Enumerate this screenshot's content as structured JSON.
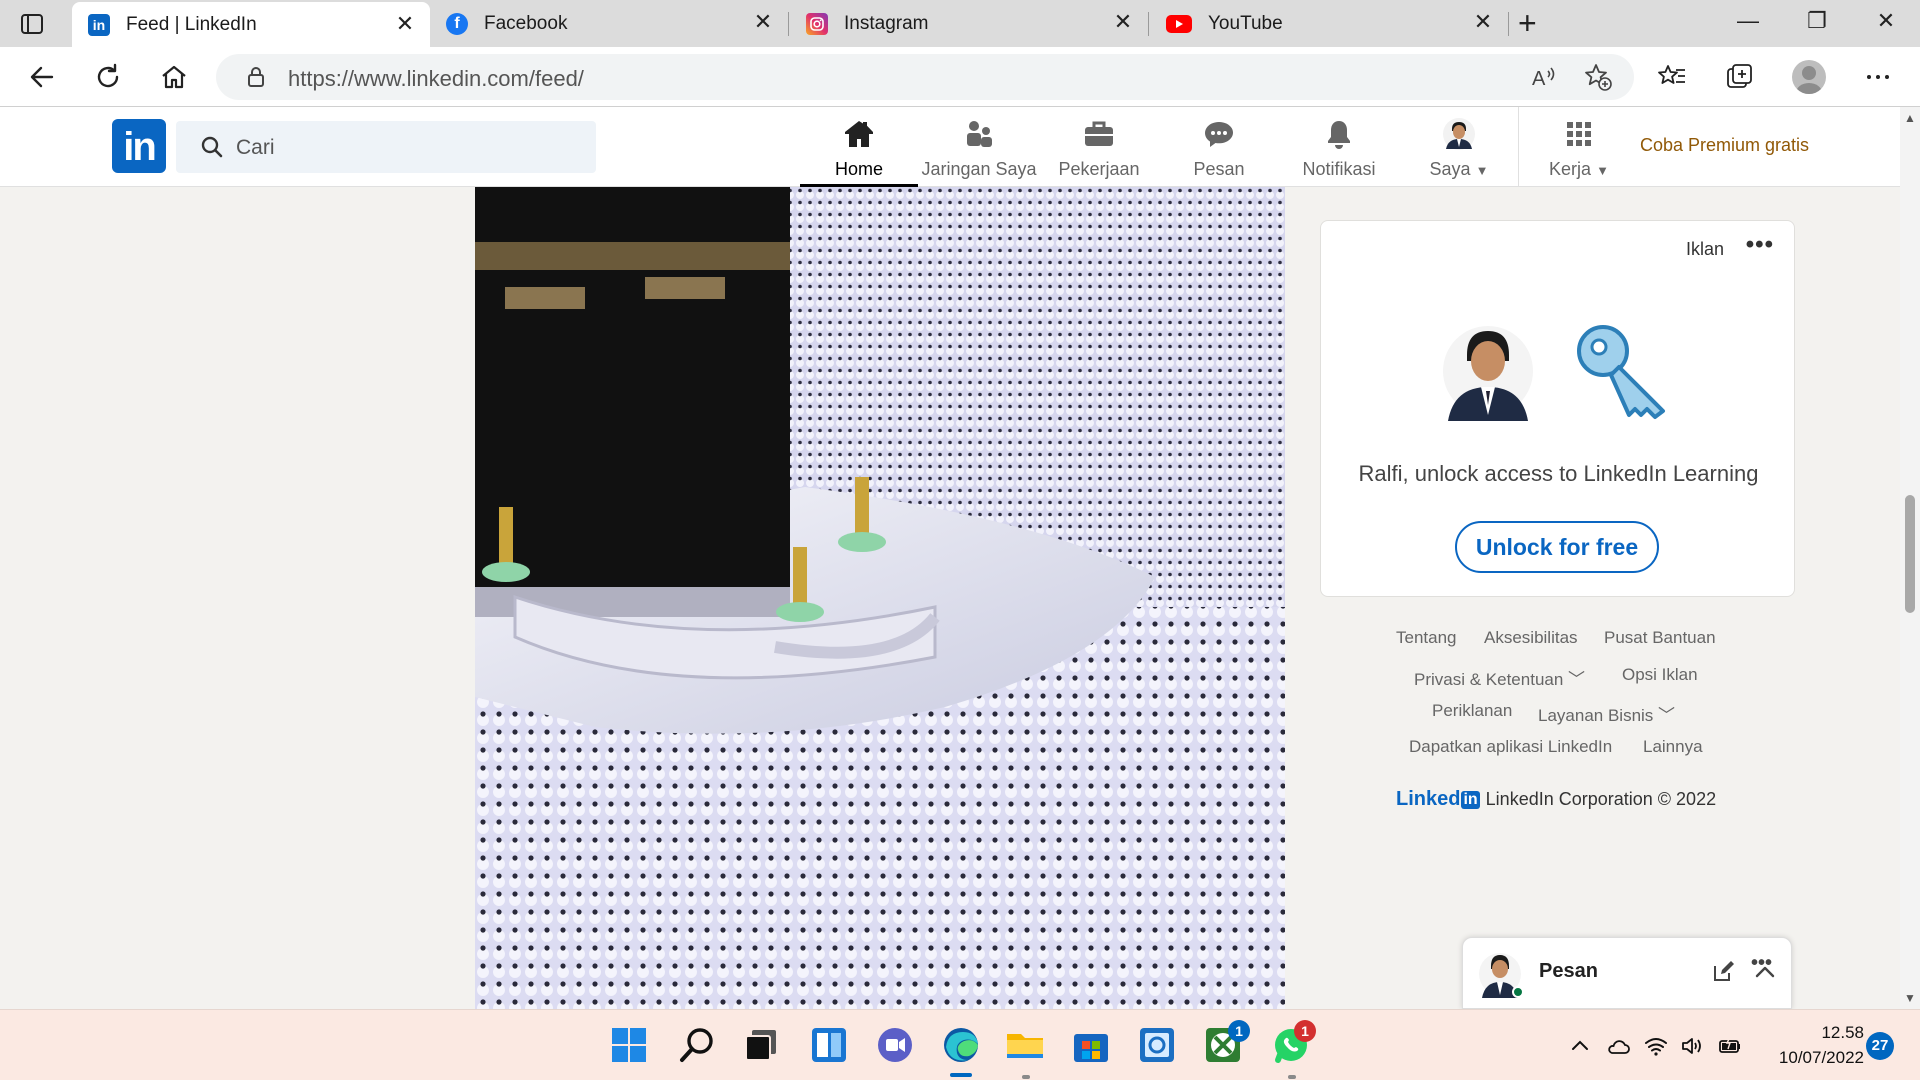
{
  "browser": {
    "tabs": [
      {
        "title": "Feed | LinkedIn",
        "icon": "linkedin-icon",
        "active": true
      },
      {
        "title": "Facebook",
        "icon": "facebook-icon",
        "active": false
      },
      {
        "title": "Instagram",
        "icon": "instagram-icon",
        "active": false
      },
      {
        "title": "YouTube",
        "icon": "youtube-icon",
        "active": false
      }
    ],
    "url": "https://www.linkedin.com/feed/",
    "url_host": "https://www.linkedin.com",
    "url_path": "/feed/"
  },
  "linkedin": {
    "logo": "in",
    "search_placeholder": "Cari",
    "nav": [
      {
        "label": "Home",
        "icon": "home-icon",
        "active": true
      },
      {
        "label": "Jaringan Saya",
        "icon": "network-icon",
        "active": false
      },
      {
        "label": "Pekerjaan",
        "icon": "briefcase-icon",
        "active": false
      },
      {
        "label": "Pesan",
        "icon": "message-icon",
        "active": false
      },
      {
        "label": "Notifikasi",
        "icon": "bell-icon",
        "active": false
      },
      {
        "label": "Saya",
        "icon": "profile-avatar",
        "active": false,
        "dropdown": true
      },
      {
        "label": "Kerja",
        "icon": "grid-icon",
        "active": false,
        "dropdown": true
      }
    ],
    "premium_link": "Coba Premium gratis"
  },
  "ad": {
    "label": "Iklan",
    "text": "Ralfi, unlock access to LinkedIn Learning",
    "button": "Unlock for free"
  },
  "footer": {
    "links": [
      {
        "label": "Tentang"
      },
      {
        "label": "Aksesibilitas"
      },
      {
        "label": "Pusat Bantuan"
      },
      {
        "label": "Privasi & Ketentuan",
        "dropdown": true
      },
      {
        "label": "Opsi Iklan"
      },
      {
        "label": "Periklanan"
      },
      {
        "label": "Layanan Bisnis",
        "dropdown": true
      },
      {
        "label": "Dapatkan aplikasi LinkedIn"
      },
      {
        "label": "Lainnya"
      }
    ],
    "brand_word": "Linked",
    "brand_in": "in",
    "copyright": "LinkedIn Corporation © 2022"
  },
  "messaging": {
    "title": "Pesan"
  },
  "taskbar": {
    "apps": [
      {
        "name": "start",
        "icon": "windows-start-icon"
      },
      {
        "name": "search",
        "icon": "search-icon"
      },
      {
        "name": "task-view",
        "icon": "task-view-icon"
      },
      {
        "name": "widgets",
        "icon": "widgets-icon"
      },
      {
        "name": "chat",
        "icon": "teams-chat-icon"
      },
      {
        "name": "edge",
        "icon": "edge-icon"
      },
      {
        "name": "file-explorer",
        "icon": "folder-icon"
      },
      {
        "name": "store",
        "icon": "store-icon"
      },
      {
        "name": "photos",
        "icon": "photos-icon"
      },
      {
        "name": "xbox",
        "icon": "xbox-icon",
        "badge": "1"
      },
      {
        "name": "whatsapp",
        "icon": "whatsapp-icon",
        "badge": "1"
      }
    ],
    "time": "12.58",
    "date": "10/07/2022",
    "notifications": "27"
  },
  "colors": {
    "linkedin_blue": "#0a66c2",
    "premium": "#915907",
    "taskbar": "#fbe9e2"
  }
}
